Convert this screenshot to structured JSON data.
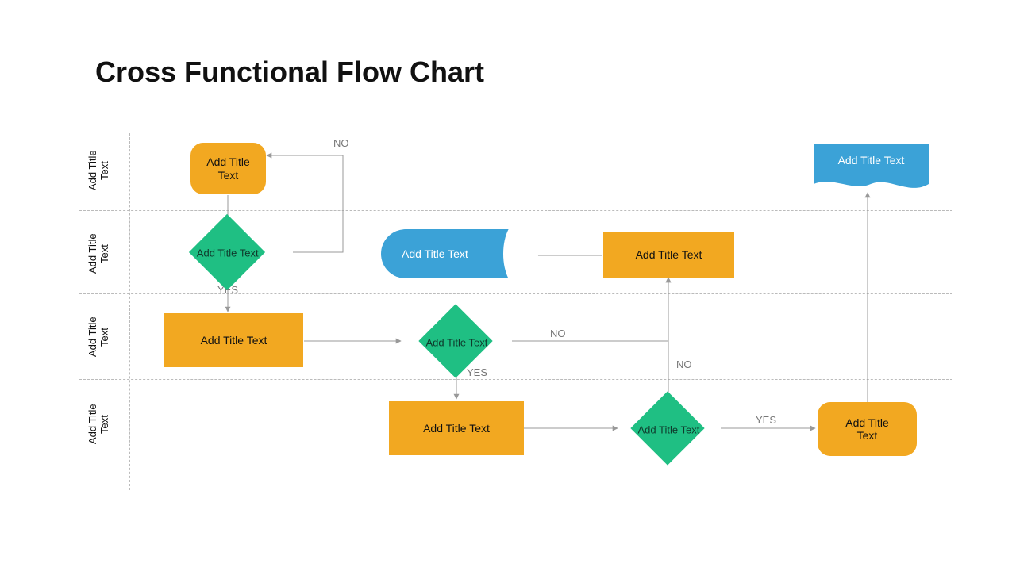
{
  "colors": {
    "orange": "#f2a821",
    "green": "#1fbf83",
    "blue": "#3ba2d7",
    "line": "#999999"
  },
  "title": "Cross Functional Flow Chart",
  "lanes": [
    {
      "id": "lane1",
      "line1": "Add Title",
      "line2": "Text"
    },
    {
      "id": "lane2",
      "line1": "Add Title",
      "line2": "Text"
    },
    {
      "id": "lane3",
      "line1": "Add Title",
      "line2": "Text"
    },
    {
      "id": "lane4",
      "line1": "Add Title",
      "line2": "Text"
    }
  ],
  "nodes": {
    "start": {
      "text_l1": "Add Title",
      "text_l2": "Text",
      "shape": "rounded-rect",
      "lane": 1
    },
    "decision1": {
      "text": "Add Title Text",
      "shape": "decision",
      "lane": 2
    },
    "process1": {
      "text": "Add Title Text",
      "shape": "process",
      "lane": 3
    },
    "decision2": {
      "text": "Add Title Text",
      "shape": "decision",
      "lane": 3
    },
    "process2": {
      "text": "Add Title Text",
      "shape": "process",
      "lane": 4
    },
    "decision3": {
      "text": "Add Title Text",
      "shape": "decision",
      "lane": 4
    },
    "process3": {
      "text_l1": "Add Title",
      "text_l2": "Text",
      "shape": "rounded-rect",
      "lane": 4
    },
    "process4": {
      "text": "Add Title Text",
      "shape": "process",
      "lane": 2
    },
    "delay": {
      "text": "Add Title Text",
      "shape": "delay",
      "lane": 2
    },
    "doc": {
      "text": "Add Title Text",
      "shape": "document",
      "lane": 1
    }
  },
  "edge_labels": {
    "decision1_no": "NO",
    "decision1_yes": "YES",
    "decision2_no": "NO",
    "decision2_yes": "YES",
    "decision3_no": "NO",
    "decision3_yes": "YES"
  }
}
